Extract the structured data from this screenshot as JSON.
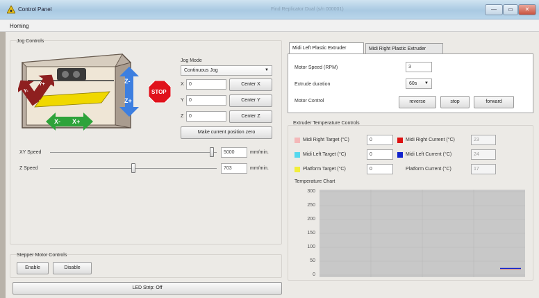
{
  "window": {
    "title": "Control Panel",
    "subtitle": "Find Replicator Dual (s/n 000001)",
    "minimize_glyph": "—",
    "maximize_glyph": "▭",
    "close_glyph": "✕"
  },
  "menu": {
    "homing": "Homing"
  },
  "jog": {
    "group_title": "Jog Controls",
    "mode_label": "Jog Mode",
    "mode_value": "Continuous Jog",
    "x_label": "X",
    "x_value": "0",
    "y_label": "Y",
    "y_value": "0",
    "z_label": "Z",
    "z_value": "0",
    "center_x": "Center X",
    "center_y": "Center Y",
    "center_z": "Center Z",
    "make_zero": "Make current position zero",
    "stop_label": "STOP",
    "y_minus": "Y-",
    "y_plus": "Y+",
    "x_minus": "X-",
    "x_plus": "X+",
    "z_minus": "Z-",
    "z_plus": "Z+"
  },
  "speed": {
    "xy_label": "XY Speed",
    "xy_value": "5000",
    "xy_fraction": 0.97,
    "z_label": "Z Speed",
    "z_value": "703",
    "z_fraction": 0.5,
    "unit": "mm/min."
  },
  "stepper": {
    "group_title": "Stepper Motor Controls",
    "enable": "Enable",
    "disable": "Disable"
  },
  "led": {
    "label": "LED Strip: Off"
  },
  "extruder_tabs": {
    "left": "Midi Left Plastic Extruder",
    "right": "Midi Right Plastic Extruder"
  },
  "extruder": {
    "motor_speed_label": "Motor Speed (RPM)",
    "motor_speed_value": "3",
    "duration_label": "Extrude duration",
    "duration_value": "60s",
    "motor_control_label": "Motor Control",
    "reverse": "reverse",
    "stop": "stop",
    "forward": "forward"
  },
  "temperature": {
    "group_title": "Extruder Temperature Controls",
    "right_target_label": "Midi Right Target (°C)",
    "right_target_value": "0",
    "left_target_label": "Midi Left Target (°C)",
    "left_target_value": "0",
    "platform_target_label": "Platform Target (°C)",
    "platform_target_value": "0",
    "right_current_label": "Midi Right Current (°C)",
    "right_current_value": "23",
    "left_current_label": "Midi Left Current (°C)",
    "left_current_value": "24",
    "platform_current_label": "Platform Current (°C)",
    "platform_current_value": "17",
    "colors": {
      "right_target": "#f4b8b8",
      "left_target": "#55d8ee",
      "platform_target": "#f2ee3a",
      "right_current": "#dd1111",
      "left_current": "#1122cc"
    }
  },
  "chart_data": {
    "type": "line",
    "title": "Temperature Chart",
    "ylim": [
      0,
      300
    ],
    "yticks": [
      "300",
      "250",
      "200",
      "150",
      "100",
      "50",
      "0"
    ],
    "grid": true,
    "series": [
      {
        "color": "#dd1111",
        "values": [
          23,
          23
        ]
      },
      {
        "color": "#1122cc",
        "values": [
          24,
          24
        ]
      }
    ]
  }
}
